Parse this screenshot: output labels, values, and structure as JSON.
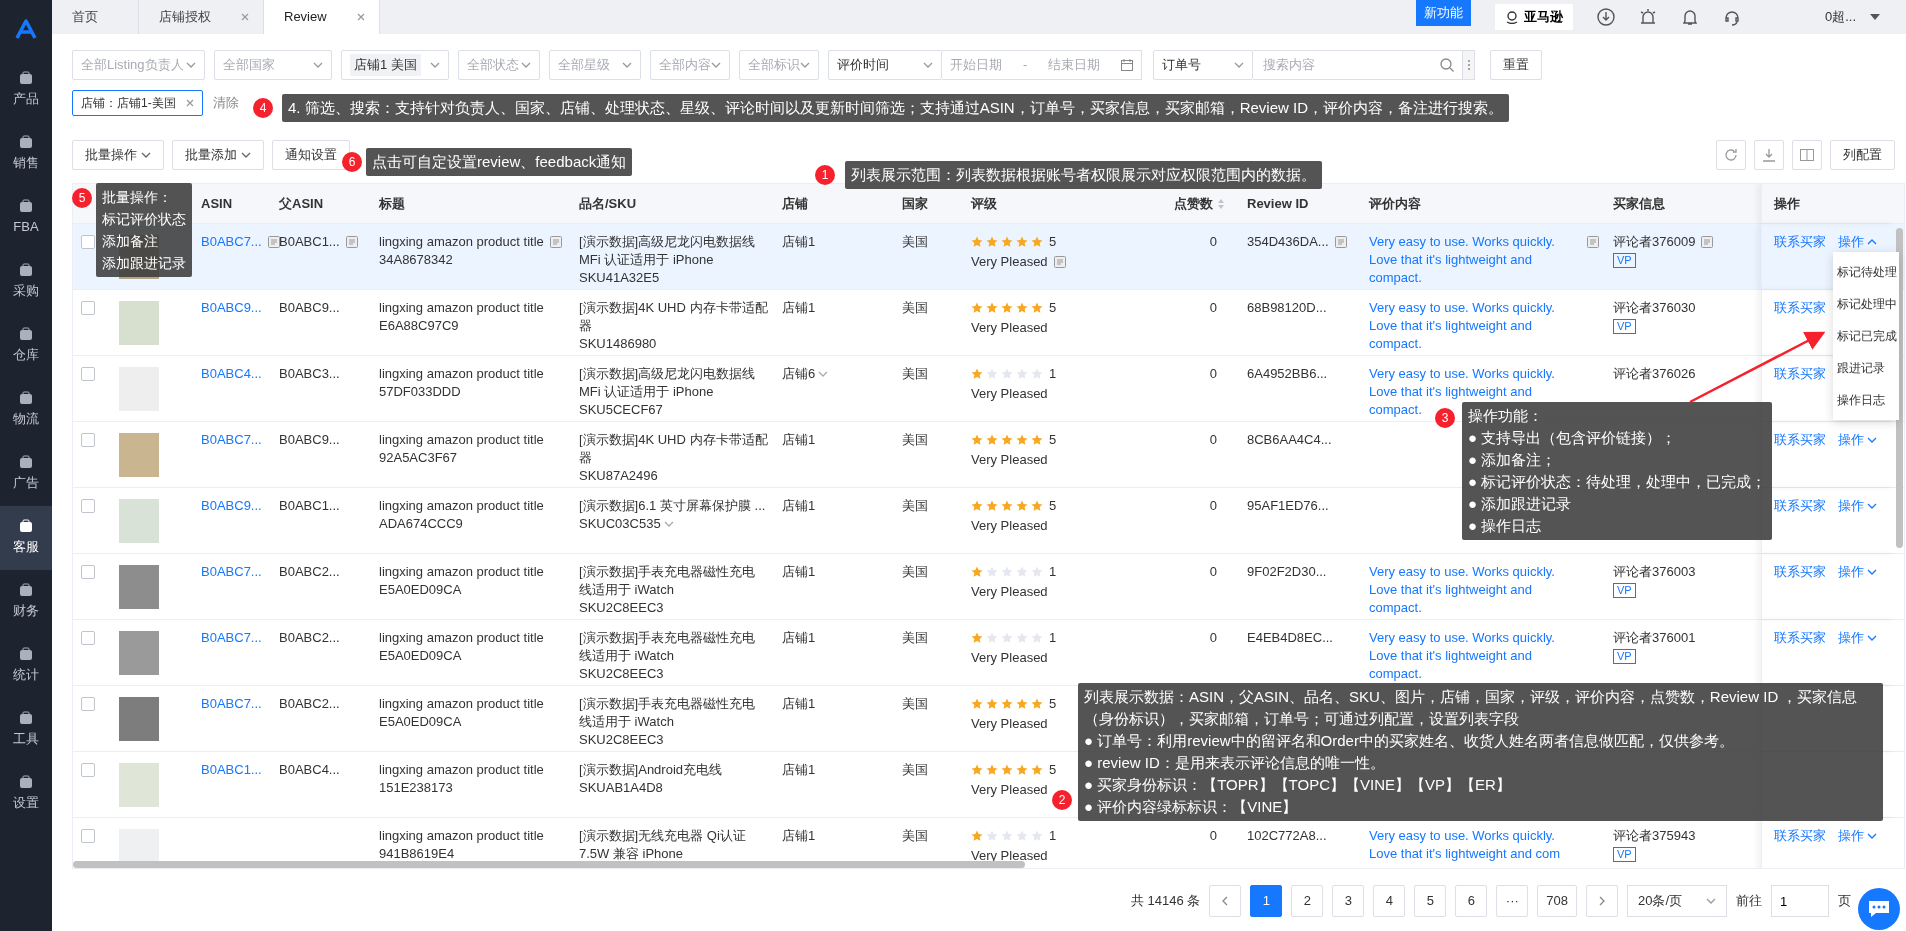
{
  "sidebar": {
    "items": [
      {
        "label": "产品",
        "selected": false
      },
      {
        "label": "销售",
        "selected": false
      },
      {
        "label": "FBA",
        "selected": false
      },
      {
        "label": "采购",
        "selected": false
      },
      {
        "label": "仓库",
        "selected": false
      },
      {
        "label": "物流",
        "selected": false
      },
      {
        "label": "广告",
        "selected": false
      },
      {
        "label": "客服",
        "selected": true
      },
      {
        "label": "财务",
        "selected": false
      },
      {
        "label": "统计",
        "selected": false
      },
      {
        "label": "工具",
        "selected": false
      },
      {
        "label": "设置",
        "selected": false
      }
    ]
  },
  "tabs": [
    {
      "label": "首页",
      "closable": false,
      "selected": false
    },
    {
      "label": "店铺授权",
      "closable": true,
      "selected": false
    },
    {
      "label": "Review",
      "closable": true,
      "selected": true
    }
  ],
  "header": {
    "new_badge": "新功能",
    "store_button": "亚马逊",
    "user": "0超..."
  },
  "filters": [
    {
      "kind": "select",
      "placeholder": "全部Listing负责人"
    },
    {
      "kind": "select",
      "placeholder": "全部国家"
    },
    {
      "kind": "tag-select",
      "value": "店铺1 美国"
    },
    {
      "kind": "select",
      "placeholder": "全部状态"
    },
    {
      "kind": "select",
      "placeholder": "全部星级"
    },
    {
      "kind": "select",
      "placeholder": "全部内容"
    },
    {
      "kind": "select",
      "placeholder": "全部标识"
    }
  ],
  "date_filter": {
    "field": "评价时间",
    "start_placeholder": "开始日期",
    "separator": "-",
    "end_placeholder": "结束日期"
  },
  "search": {
    "field": "订单号",
    "placeholder": "搜索内容"
  },
  "reset_button": "重置",
  "active_filters": [
    {
      "label": "店铺：店铺1-美国"
    }
  ],
  "clear_link": "清除",
  "toolbar": {
    "buttons": [
      {
        "label": "批量操作",
        "menu": true
      },
      {
        "label": "批量添加",
        "menu": true
      },
      {
        "label": "通知设置",
        "menu": false
      }
    ],
    "column_settings": "列配置"
  },
  "columns": [
    {
      "label": "ASIN",
      "sortable": false
    },
    {
      "label": "父ASIN",
      "sortable": false
    },
    {
      "label": "标题",
      "sortable": false
    },
    {
      "label": "品名/SKU",
      "sortable": false
    },
    {
      "label": "店铺",
      "sortable": false
    },
    {
      "label": "国家",
      "sortable": false
    },
    {
      "label": "评级",
      "sortable": false
    },
    {
      "label": "点赞数",
      "sortable": true
    },
    {
      "label": "Review ID",
      "sortable": false
    },
    {
      "label": "评价内容",
      "sortable": false
    },
    {
      "label": "买家信息",
      "sortable": false
    },
    {
      "label": "操作",
      "sortable": false
    }
  ],
  "rows": [
    {
      "checked": false,
      "highlighted": true,
      "asin": "B0ABC7...",
      "parent_asin": "B0ABC1...",
      "title": "lingxing amazon product title 34A8678342",
      "product": "[演示数据]高级尼龙闪电数据线 MFi 认证适用于 iPhone",
      "sku": "SKU41A32E5",
      "sku_menu": false,
      "shop": "店铺1",
      "shop_menu": false,
      "country": "美国",
      "stars": 5,
      "rating": "5",
      "sentiment": "Very Pleased",
      "likes": "0",
      "review_id": "354D436DA...",
      "review": "Very easy to use. Works quickly. Love that it's lightweight and compact.",
      "buyer": "评论者376009",
      "tag": "VP",
      "contact": "联系买家",
      "ops": {
        "label": "操作",
        "expanded": true
      }
    },
    {
      "checked": false,
      "highlighted": false,
      "asin": "B0ABC9...",
      "parent_asin": "B0ABC9...",
      "title": "lingxing amazon product title E6A88C97C9",
      "product": "[演示数据]4K UHD 内存卡带适配器",
      "sku": "SKU1486980",
      "sku_menu": false,
      "shop": "店铺1",
      "shop_menu": false,
      "country": "美国",
      "stars": 5,
      "rating": "5",
      "sentiment": "Very Pleased",
      "likes": "0",
      "review_id": "68B98120D...",
      "review": "Very easy to use. Works quickly. Love that it's lightweight and compact.",
      "buyer": "评论者376030",
      "tag": "VP",
      "contact": "联系买家"
    },
    {
      "checked": false,
      "highlighted": false,
      "asin": "B0ABC4...",
      "parent_asin": "B0ABC3...",
      "title": "lingxing amazon product title 57DF033DDD",
      "product": "[演示数据]高级尼龙闪电数据线 MFi 认证适用于 iPhone",
      "sku": "SKU5CECF67",
      "sku_menu": false,
      "shop": "店铺6",
      "shop_menu": true,
      "country": "美国",
      "stars": 1,
      "rating": "1",
      "sentiment": "Very Pleased",
      "likes": "0",
      "review_id": "6A4952BB6...",
      "review": "Very easy to use. Works quickly. Love that it's lightweight and compact.",
      "buyer": "评论者376026",
      "contact": "联系买家"
    },
    {
      "checked": false,
      "highlighted": false,
      "asin": "B0ABC7...",
      "parent_asin": "B0ABC9...",
      "title": "lingxing amazon product title 92A5AC3F67",
      "product": "[演示数据]4K UHD 内存卡带适配器",
      "sku": "SKU87A2496",
      "sku_menu": false,
      "shop": "店铺1",
      "shop_menu": false,
      "country": "美国",
      "stars": 5,
      "rating": "5",
      "sentiment": "Very Pleased",
      "likes": "0",
      "review_id": "8CB6AA4C4...",
      "contact": "联系买家",
      "ops": {
        "label": "操作",
        "expanded": false
      }
    },
    {
      "checked": false,
      "highlighted": false,
      "asin": "B0ABC9...",
      "parent_asin": "B0ABC1...",
      "title": "lingxing amazon product title ADA674CCC9",
      "product": "[演示数据]6.1 英寸屏幕保护膜 ...",
      "sku": "SKUC03C535",
      "sku_menu": true,
      "shop": "店铺1",
      "shop_menu": false,
      "country": "美国",
      "stars": 5,
      "rating": "5",
      "sentiment": "Very Pleased",
      "likes": "0",
      "review_id": "95AF1ED76...",
      "contact": "联系买家",
      "ops": {
        "label": "操作",
        "expanded": false
      }
    },
    {
      "checked": false,
      "highlighted": false,
      "asin": "B0ABC7...",
      "parent_asin": "B0ABC2...",
      "title": "lingxing amazon product title E5A0ED09CA",
      "product": "[演示数据]手表充电器磁性充电线适用于 iWatch",
      "sku": "SKU2C8EEC3",
      "sku_menu": false,
      "shop": "店铺1",
      "shop_menu": false,
      "country": "美国",
      "stars": 1,
      "rating": "1",
      "sentiment": "Very Pleased",
      "likes": "0",
      "review_id": "9F02F2D30...",
      "review": "Very easy to use. Works quickly. Love that it's lightweight and compact.",
      "buyer": "评论者376003",
      "tag": "VP",
      "contact": "联系买家",
      "ops": {
        "label": "操作",
        "expanded": false
      }
    },
    {
      "checked": false,
      "highlighted": false,
      "asin": "B0ABC7...",
      "parent_asin": "B0ABC2...",
      "title": "lingxing amazon product title E5A0ED09CA",
      "product": "[演示数据]手表充电器磁性充电线适用于 iWatch",
      "sku": "SKU2C8EEC3",
      "sku_menu": false,
      "shop": "店铺1",
      "shop_menu": false,
      "country": "美国",
      "stars": 1,
      "rating": "1",
      "sentiment": "Very Pleased",
      "likes": "0",
      "review_id": "E4EB4D8EC...",
      "review": "Very easy to use. Works quickly. Love that it's lightweight and compact.",
      "buyer": "评论者376001",
      "tag": "VP",
      "contact": "联系买家",
      "ops": {
        "label": "操作",
        "expanded": false
      }
    },
    {
      "checked": false,
      "highlighted": false,
      "asin": "B0ABC7...",
      "parent_asin": "B0ABC2...",
      "title": "lingxing amazon product title E5A0ED09CA",
      "product": "[演示数据]手表充电器磁性充电线适用于 iWatch",
      "sku": "SKU2C8EEC3",
      "sku_menu": false,
      "shop": "店铺1",
      "shop_menu": false,
      "country": "美国",
      "stars": 5,
      "rating": "5",
      "sentiment": "Very Pleased"
    },
    {
      "checked": false,
      "highlighted": false,
      "asin": "B0ABC1...",
      "parent_asin": "B0ABC4...",
      "title": "lingxing amazon product title 151E238173",
      "product": "[演示数据]Android充电线",
      "sku": "SKUAB1A4D8",
      "sku_menu": false,
      "shop": "店铺1",
      "shop_menu": false,
      "country": "美国",
      "stars": 5,
      "rating": "5",
      "sentiment": "Very Pleased"
    },
    {
      "checked": false,
      "highlighted": false,
      "title": "lingxing amazon product title 941B8619E4",
      "product": "[演示数据]无线充电器 Qi认证 7.5W 兼容 iPhone",
      "shop": "店铺1",
      "shop_menu": false,
      "country": "美国",
      "stars": 1,
      "rating": "1",
      "sentiment": "Very Pleased",
      "likes": "0",
      "review_id": "102C772A8...",
      "review": "Very easy to use. Works quickly. Love that it's lightweight and com",
      "buyer": "评论者375943",
      "tag": "VP",
      "contact": "联系买家",
      "ops": {
        "label": "操作",
        "expanded": false
      }
    }
  ],
  "ops_menu": [
    "标记待处理",
    "标记处理中",
    "标记已完成",
    "跟进记录",
    "操作日志"
  ],
  "pagination": {
    "total": "共 14146 条",
    "pages": [
      {
        "label": "1",
        "selected": true
      },
      {
        "label": "2",
        "selected": false
      },
      {
        "label": "3",
        "selected": false
      },
      {
        "label": "4",
        "selected": false
      },
      {
        "label": "5",
        "selected": false
      },
      {
        "label": "6",
        "selected": false
      },
      {
        "label": "···",
        "selected": false
      },
      {
        "label": "708",
        "selected": false
      }
    ],
    "page_size": "20条/页",
    "goto_label": "前往",
    "goto_value": "1",
    "goto_suffix": "页"
  },
  "callouts": [
    {
      "number": "4",
      "lines": [
        "4. 筛选、搜索：支持针对负责人、国家、店铺、处理状态、星级、评论时间以及更新时间筛选；支持通过ASIN，订单号，买家信息，买家邮箱，Review ID，评价内容，备注进行搜索。"
      ]
    },
    {
      "number": "6",
      "lines": [
        "点击可自定设置review、feedback通知"
      ]
    },
    {
      "number": "1",
      "lines": [
        "列表展示范围：列表数据根据账号者权限展示对应权限范围内的数据。"
      ]
    },
    {
      "number": "5",
      "lines": [
        "批量操作：",
        "标记评价状态",
        "添加备注",
        "添加跟进记录"
      ]
    },
    {
      "number": "3",
      "lines": [
        "操作功能：",
        "● 支持导出（包含评价链接）；",
        "● 添加备注；",
        "● 标记评价状态：待处理，处理中，已完成；",
        "● 添加跟进记录",
        "● 操作日志"
      ]
    },
    {
      "number": "2",
      "lines": [
        "列表展示数据：ASIN，父ASIN、品名、SKU、图片，店铺，国家，评级，评价内容，点赞数，Review ID ，买家信息（身份标识），买家邮箱，订单号；可通过列配置，设置列表字段",
        "● 订单号：利用review中的留评名和Order中的买家姓名、收货人姓名两者信息做匹配，仅供参考。",
        "● review ID：是用来表示评论信息的唯一性。",
        "● 买家身份标识：【TOPR】【TOPC】【VINE】【VP】【ER】",
        "● 评价内容绿标标识：【VINE】"
      ]
    }
  ]
}
